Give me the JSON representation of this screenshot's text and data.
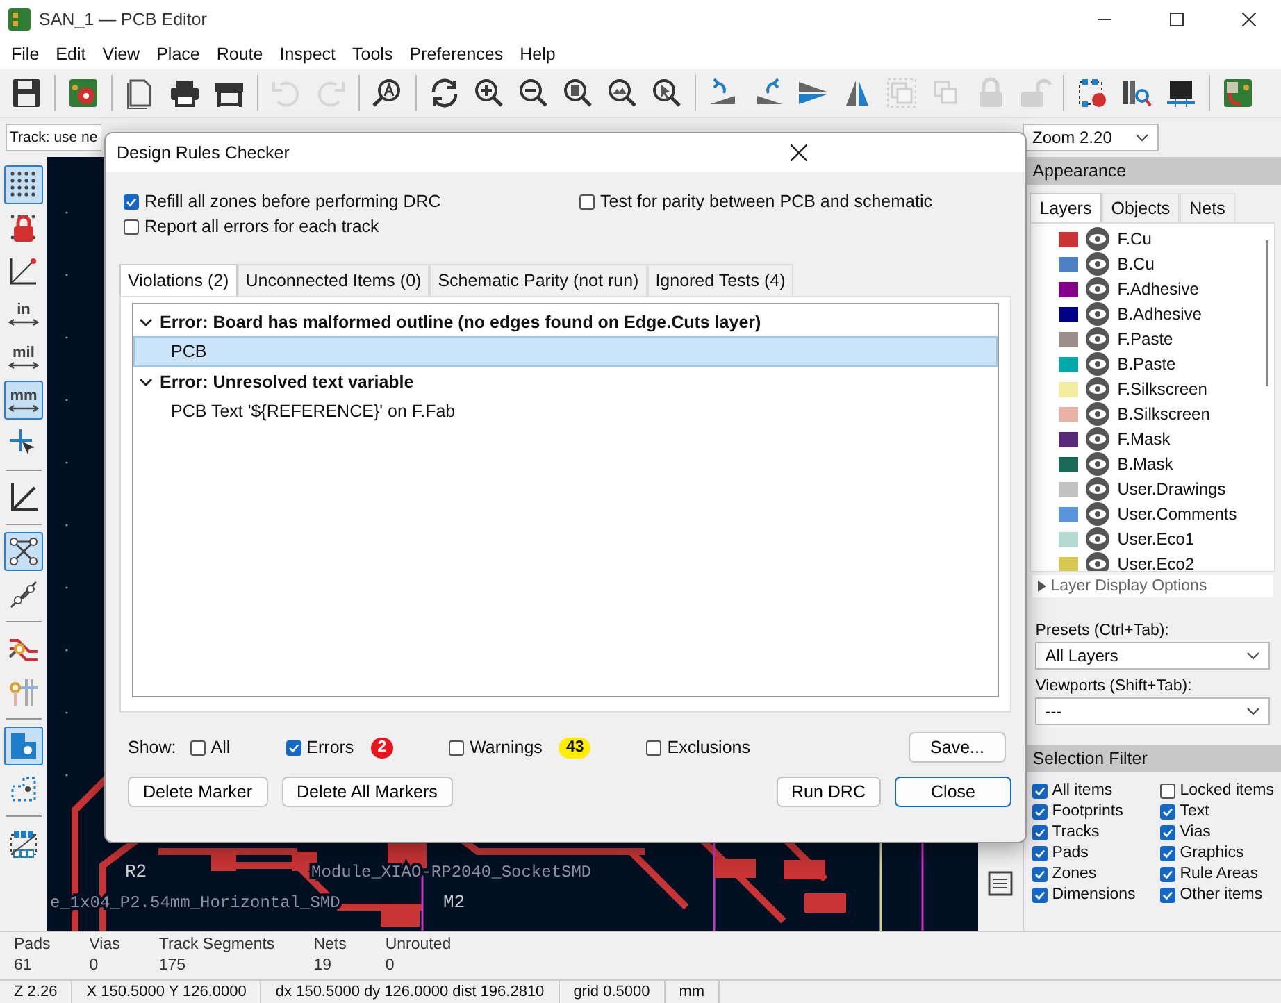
{
  "window": {
    "title": "SAN_1 — PCB Editor"
  },
  "menu": [
    "File",
    "Edit",
    "View",
    "Place",
    "Route",
    "Inspect",
    "Tools",
    "Preferences",
    "Help"
  ],
  "toolbar": [
    {
      "kind": "save",
      "disabled": false
    },
    {
      "kind": "separator"
    },
    {
      "kind": "board",
      "disabled": false
    },
    {
      "kind": "separator"
    },
    {
      "kind": "page",
      "disabled": false
    },
    {
      "kind": "print",
      "disabled": false
    },
    {
      "kind": "plot",
      "disabled": false
    },
    {
      "kind": "separator"
    },
    {
      "kind": "undo",
      "disabled": true
    },
    {
      "kind": "redo",
      "disabled": true
    },
    {
      "kind": "separator"
    },
    {
      "kind": "find",
      "disabled": false
    },
    {
      "kind": "separator"
    },
    {
      "kind": "refresh",
      "disabled": false
    },
    {
      "kind": "zoomin",
      "disabled": false
    },
    {
      "kind": "zoomout",
      "disabled": false
    },
    {
      "kind": "zoomfit",
      "disabled": false
    },
    {
      "kind": "zoomobj",
      "disabled": false
    },
    {
      "kind": "zoomsel",
      "disabled": false
    },
    {
      "kind": "separator"
    },
    {
      "kind": "rotl",
      "disabled": false
    },
    {
      "kind": "rotr",
      "disabled": false
    },
    {
      "kind": "flipv",
      "disabled": false
    },
    {
      "kind": "fliph",
      "disabled": false
    },
    {
      "kind": "group",
      "disabled": true
    },
    {
      "kind": "ungroup",
      "disabled": true
    },
    {
      "kind": "lock",
      "disabled": true
    },
    {
      "kind": "unlock",
      "disabled": true
    },
    {
      "kind": "separator"
    },
    {
      "kind": "fpedit",
      "disabled": false
    },
    {
      "kind": "fplib",
      "disabled": false
    },
    {
      "kind": "chip",
      "disabled": false
    },
    {
      "kind": "separator"
    },
    {
      "kind": "script",
      "disabled": false
    }
  ],
  "aux_toolbar": {
    "track_width": "Track: use ne",
    "zoom": "Zoom 2.20"
  },
  "left_toolbar": [
    {
      "kind": "grid",
      "selected": true
    },
    {
      "kind": "gridlock",
      "selected": false
    },
    {
      "kind": "polar",
      "selected": false
    },
    {
      "kind": "unit",
      "label": "in",
      "selected": false
    },
    {
      "kind": "unit",
      "label": "mil",
      "selected": false
    },
    {
      "kind": "unit",
      "label": "mm",
      "selected": true
    },
    {
      "kind": "cursor",
      "selected": false
    },
    {
      "kind": "separator"
    },
    {
      "kind": "angle",
      "selected": false
    },
    {
      "kind": "separator"
    },
    {
      "kind": "ratsnest",
      "selected": true
    },
    {
      "kind": "curved",
      "selected": false
    },
    {
      "kind": "separator"
    },
    {
      "kind": "tracks",
      "selected": false
    },
    {
      "kind": "vias",
      "selected": false
    },
    {
      "kind": "separator"
    },
    {
      "kind": "zonefill",
      "selected": true
    },
    {
      "kind": "zoneoutline",
      "selected": false
    },
    {
      "kind": "separator"
    },
    {
      "kind": "footprint",
      "selected": false
    }
  ],
  "canvas": {
    "labels": [
      {
        "text": "R2",
        "kind": "ref"
      },
      {
        "text": "Module_XIAO-RP2040_SocketSMD",
        "kind": "value"
      },
      {
        "text": "e_1x04_P2.54mm_Horizontal_SMD",
        "kind": "value"
      },
      {
        "text": "M2",
        "kind": "ref"
      }
    ]
  },
  "appearance": {
    "title": "Appearance",
    "tabs": [
      {
        "label": "Layers",
        "selected": true
      },
      {
        "label": "Objects",
        "selected": false
      },
      {
        "label": "Nets",
        "selected": false
      }
    ],
    "layers": [
      {
        "name": "F.Cu",
        "color": "#c83434",
        "visible": true
      },
      {
        "name": "B.Cu",
        "color": "#4d7fc4",
        "visible": true
      },
      {
        "name": "F.Adhesive",
        "color": "#84008a",
        "visible": true
      },
      {
        "name": "B.Adhesive",
        "color": "#000084",
        "visible": true
      },
      {
        "name": "F.Paste",
        "color": "#9b8f8a",
        "visible": true
      },
      {
        "name": "B.Paste",
        "color": "#00aaaa",
        "visible": true
      },
      {
        "name": "F.Silkscreen",
        "color": "#f2eda1",
        "visible": true
      },
      {
        "name": "B.Silkscreen",
        "color": "#e8b2a7",
        "visible": true
      },
      {
        "name": "F.Mask",
        "color": "#5a2a7a",
        "visible": true
      },
      {
        "name": "B.Mask",
        "color": "#1a6a5a",
        "visible": true
      },
      {
        "name": "User.Drawings",
        "color": "#c2c2c2",
        "visible": true
      },
      {
        "name": "User.Comments",
        "color": "#5994dc",
        "visible": true
      },
      {
        "name": "User.Eco1",
        "color": "#b4dbd2",
        "visible": true
      },
      {
        "name": "User.Eco2",
        "color": "#d8c852",
        "visible": true
      }
    ],
    "display_options": {
      "label": "Layer Display Options",
      "expanded": false
    },
    "presets": {
      "label": "Presets (Ctrl+Tab):",
      "value": "All Layers"
    },
    "viewports": {
      "label": "Viewports (Shift+Tab):",
      "value": "---"
    }
  },
  "selection_filter": {
    "title": "Selection Filter",
    "items": [
      {
        "label": "All items",
        "checked": true
      },
      {
        "label": "Locked items",
        "checked": false
      },
      {
        "label": "Footprints",
        "checked": true
      },
      {
        "label": "Text",
        "checked": true
      },
      {
        "label": "Tracks",
        "checked": true
      },
      {
        "label": "Vias",
        "checked": true
      },
      {
        "label": "Pads",
        "checked": true
      },
      {
        "label": "Graphics",
        "checked": true
      },
      {
        "label": "Zones",
        "checked": true
      },
      {
        "label": "Rule Areas",
        "checked": true
      },
      {
        "label": "Dimensions",
        "checked": true
      },
      {
        "label": "Other items",
        "checked": true
      }
    ]
  },
  "messages": [
    {
      "label": "Pads",
      "value": "61"
    },
    {
      "label": "Vias",
      "value": "0"
    },
    {
      "label": "Track Segments",
      "value": "175"
    },
    {
      "label": "Nets",
      "value": "19"
    },
    {
      "label": "Unrouted",
      "value": "0"
    }
  ],
  "status_bar": [
    "Z 2.26",
    "X 150.5000  Y 126.0000",
    "dx 150.5000  dy 126.0000  dist 196.2810",
    "grid 0.5000",
    "mm"
  ],
  "dialog": {
    "title": "Design Rules Checker",
    "options": [
      {
        "label": "Refill all zones before performing DRC",
        "checked": true
      },
      {
        "label": "Test for parity between PCB and schematic",
        "checked": false
      },
      {
        "label": "Report all errors for each track",
        "checked": false
      }
    ],
    "tabs": [
      {
        "label": "Violations (2)",
        "selected": true
      },
      {
        "label": "Unconnected Items (0)",
        "selected": false
      },
      {
        "label": "Schematic Parity (not run)",
        "selected": false
      },
      {
        "label": "Ignored Tests (4)",
        "selected": false
      }
    ],
    "violations": [
      {
        "title": "Error: Board has malformed outline (no edges found on Edge.Cuts layer)",
        "expanded": true,
        "children": [
          {
            "label": "PCB",
            "selected": true
          }
        ]
      },
      {
        "title": "Error: Unresolved text variable",
        "expanded": true,
        "children": [
          {
            "label": "PCB Text '${REFERENCE}' on F.Fab",
            "selected": false
          }
        ]
      }
    ],
    "show_label": "Show:",
    "filters": [
      {
        "label": "All",
        "checked": false
      },
      {
        "label": "Errors",
        "checked": true,
        "count": "2",
        "color": "#e8141e"
      },
      {
        "label": "Warnings",
        "checked": false,
        "count": "43",
        "color": "#ffee00"
      },
      {
        "label": "Exclusions",
        "checked": false
      }
    ],
    "save": "Save...",
    "buttons": [
      {
        "label": "Delete Marker",
        "default": false
      },
      {
        "label": "Delete All Markers",
        "default": false
      },
      {
        "label": "Run DRC",
        "default": false
      },
      {
        "label": "Close",
        "default": true
      }
    ]
  }
}
